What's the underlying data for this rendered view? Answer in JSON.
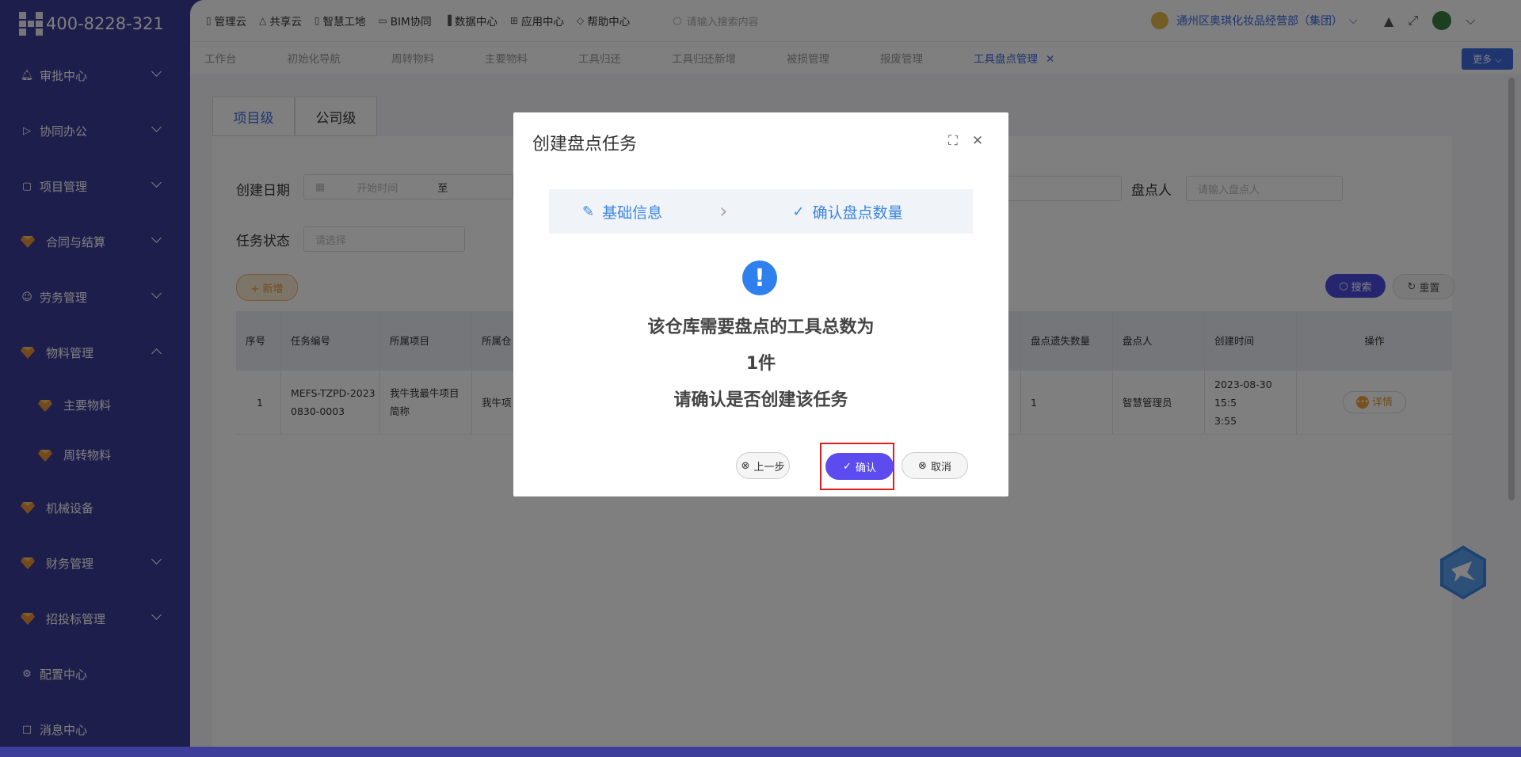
{
  "app": {
    "phone": "400-8228-321"
  },
  "sidebar": {
    "items": [
      {
        "label": "审批中心",
        "icon": "bell-icon"
      },
      {
        "label": "协同办公",
        "icon": "send-icon"
      },
      {
        "label": "项目管理",
        "icon": "book-icon"
      },
      {
        "label": "合同与结算",
        "icon": "gem-icon"
      },
      {
        "label": "劳务管理",
        "icon": "user-icon"
      },
      {
        "label": "物料管理",
        "icon": "gem-icon"
      },
      {
        "label": "主要物料",
        "icon": "gem-icon"
      },
      {
        "label": "周转物料",
        "icon": "gem-icon"
      },
      {
        "label": "机械设备",
        "icon": "gem-icon"
      },
      {
        "label": "财务管理",
        "icon": "gem-icon"
      },
      {
        "label": "招投标管理",
        "icon": "gem-icon"
      },
      {
        "label": "配置中心",
        "icon": "gear-icon"
      },
      {
        "label": "消息中心",
        "icon": "message-icon"
      }
    ]
  },
  "topnav": {
    "items": [
      "管理云",
      "共享云",
      "智慧工地",
      "BIM协同",
      "数据中心",
      "应用中心",
      "帮助中心"
    ],
    "search_placeholder": "请输入搜索内容",
    "company": "通州区奥琪化妆品经营部（集团）"
  },
  "tabs": {
    "items": [
      "工作台",
      "初始化导航",
      "周转物料",
      "主要物料",
      "工具归还",
      "工具归还新增",
      "被损管理",
      "报废管理",
      "工具盘点管理"
    ],
    "more": "更多"
  },
  "page": {
    "level_tabs": [
      "项目级",
      "公司级"
    ],
    "filters": {
      "create_date_label": "创建日期",
      "start_placeholder": "开始时间",
      "to": "至",
      "counter_label": "盘点人",
      "counter_placeholder": "请输入盘点人",
      "status_label": "任务状态",
      "status_placeholder": "请选择"
    },
    "add_btn": "+ 新增",
    "search_btn": "搜索",
    "reset_btn": "重置",
    "table": {
      "headers": [
        "序号",
        "任务编号",
        "所属项目",
        "所属仓",
        "盘点遗失数量",
        "盘点人",
        "创建时间",
        "操作"
      ],
      "rows": [
        {
          "no": "1",
          "code1": "MEFS-TZPD-2023",
          "code2": "0830-0003",
          "project1": "我牛我最牛项目",
          "project2": "简称",
          "warehouse": "我牛项",
          "lost": "1",
          "counter": "智慧管理员",
          "time1": "2023-08-30 15:5",
          "time2": "3:55",
          "action": "详情"
        }
      ]
    }
  },
  "modal": {
    "title": "创建盘点任务",
    "steps": [
      "基础信息",
      "确认盘点数量"
    ],
    "line1": "该仓库需要盘点的工具总数为",
    "line2": "1件",
    "line3": "请确认是否创建该任务",
    "prev": "上一步",
    "confirm": "确认",
    "cancel": "取消"
  },
  "colors": {
    "sidebar": "#3d3d9a",
    "primary": "#3d6ae0",
    "confirm": "#5c4cf0",
    "highlight": "#e02020"
  }
}
